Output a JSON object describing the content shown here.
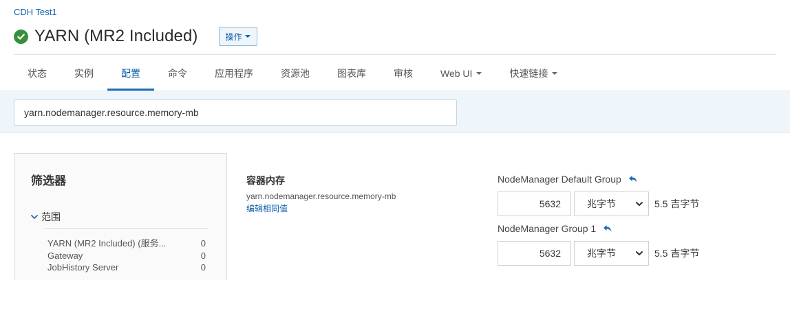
{
  "header": {
    "cluster": "CDH Test1",
    "service_title": "YARN (MR2 Included)",
    "actions_label": "操作"
  },
  "tabs": [
    {
      "label": "状态",
      "active": false
    },
    {
      "label": "实例",
      "active": false
    },
    {
      "label": "配置",
      "active": true
    },
    {
      "label": "命令",
      "active": false
    },
    {
      "label": "应用程序",
      "active": false
    },
    {
      "label": "资源池",
      "active": false
    },
    {
      "label": "图表库",
      "active": false
    },
    {
      "label": "审核",
      "active": false
    },
    {
      "label": "Web UI",
      "active": false,
      "dropdown": true
    },
    {
      "label": "快速链接",
      "active": false,
      "dropdown": true
    }
  ],
  "search": {
    "value": "yarn.nodemanager.resource.memory-mb"
  },
  "filters": {
    "title": "筛选器",
    "scope_label": "范围",
    "items": [
      {
        "label": "YARN (MR2 Included) (服务...",
        "count": "0"
      },
      {
        "label": "Gateway",
        "count": "0"
      },
      {
        "label": "JobHistory Server",
        "count": "0"
      }
    ]
  },
  "property": {
    "name": "容器内存",
    "key": "yarn.nodemanager.resource.memory-mb",
    "edit_link": "编辑相同值"
  },
  "groups": [
    {
      "label": "NodeManager Default Group",
      "value": "5632",
      "unit": "兆字节",
      "converted": "5.5 吉字节"
    },
    {
      "label": "NodeManager Group 1",
      "value": "5632",
      "unit": "兆字节",
      "converted": "5.5 吉字节"
    }
  ],
  "colors": {
    "link": "#0a5ea8",
    "status_ok": "#3a8f3c",
    "active_tab_underline": "#1f6cb3",
    "search_band": "#eef6fb"
  },
  "icons": {
    "status": "check-circle-icon",
    "scope": "chevron-down-icon",
    "revert": "undo-arrow-icon",
    "select": "chevron-down-icon"
  }
}
